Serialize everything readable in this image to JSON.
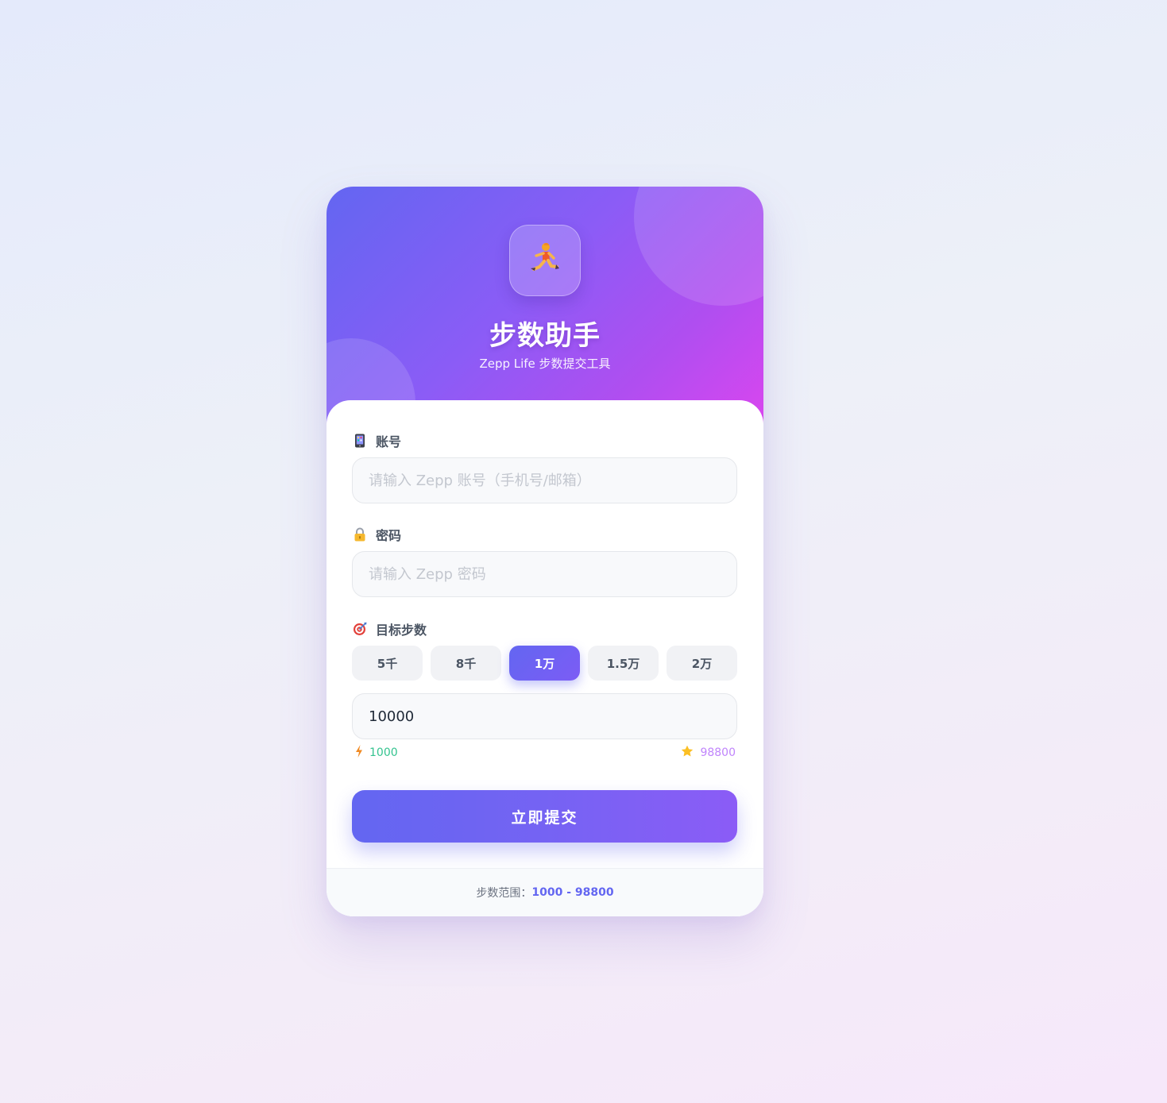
{
  "header": {
    "title": "步数助手",
    "subtitle": "Zepp Life 步数提交工具",
    "logo_icon": "running-person-icon"
  },
  "account": {
    "label": "账号",
    "icon": "phone-icon",
    "placeholder": "请输入 Zepp 账号（手机号/邮箱）",
    "value": ""
  },
  "password": {
    "label": "密码",
    "icon": "lock-icon",
    "placeholder": "请输入 Zepp 密码",
    "value": ""
  },
  "steps": {
    "label": "目标步数",
    "icon": "target-icon",
    "presets": [
      "5千",
      "8千",
      "1万",
      "1.5万",
      "2万"
    ],
    "selected_preset": "1万",
    "value": "10000",
    "min": "1000",
    "max": "98800",
    "min_icon": "lightning-icon",
    "max_icon": "star-icon"
  },
  "submit_label": "立即提交",
  "footer": {
    "range_label": "步数范围：",
    "range_value": "1000 - 98800"
  },
  "colors": {
    "accent": "#6366f1",
    "header_gradient_start": "#6366f1",
    "header_gradient_end": "#d946ef",
    "min_color": "#34c38f",
    "max_color": "#c084fc"
  }
}
